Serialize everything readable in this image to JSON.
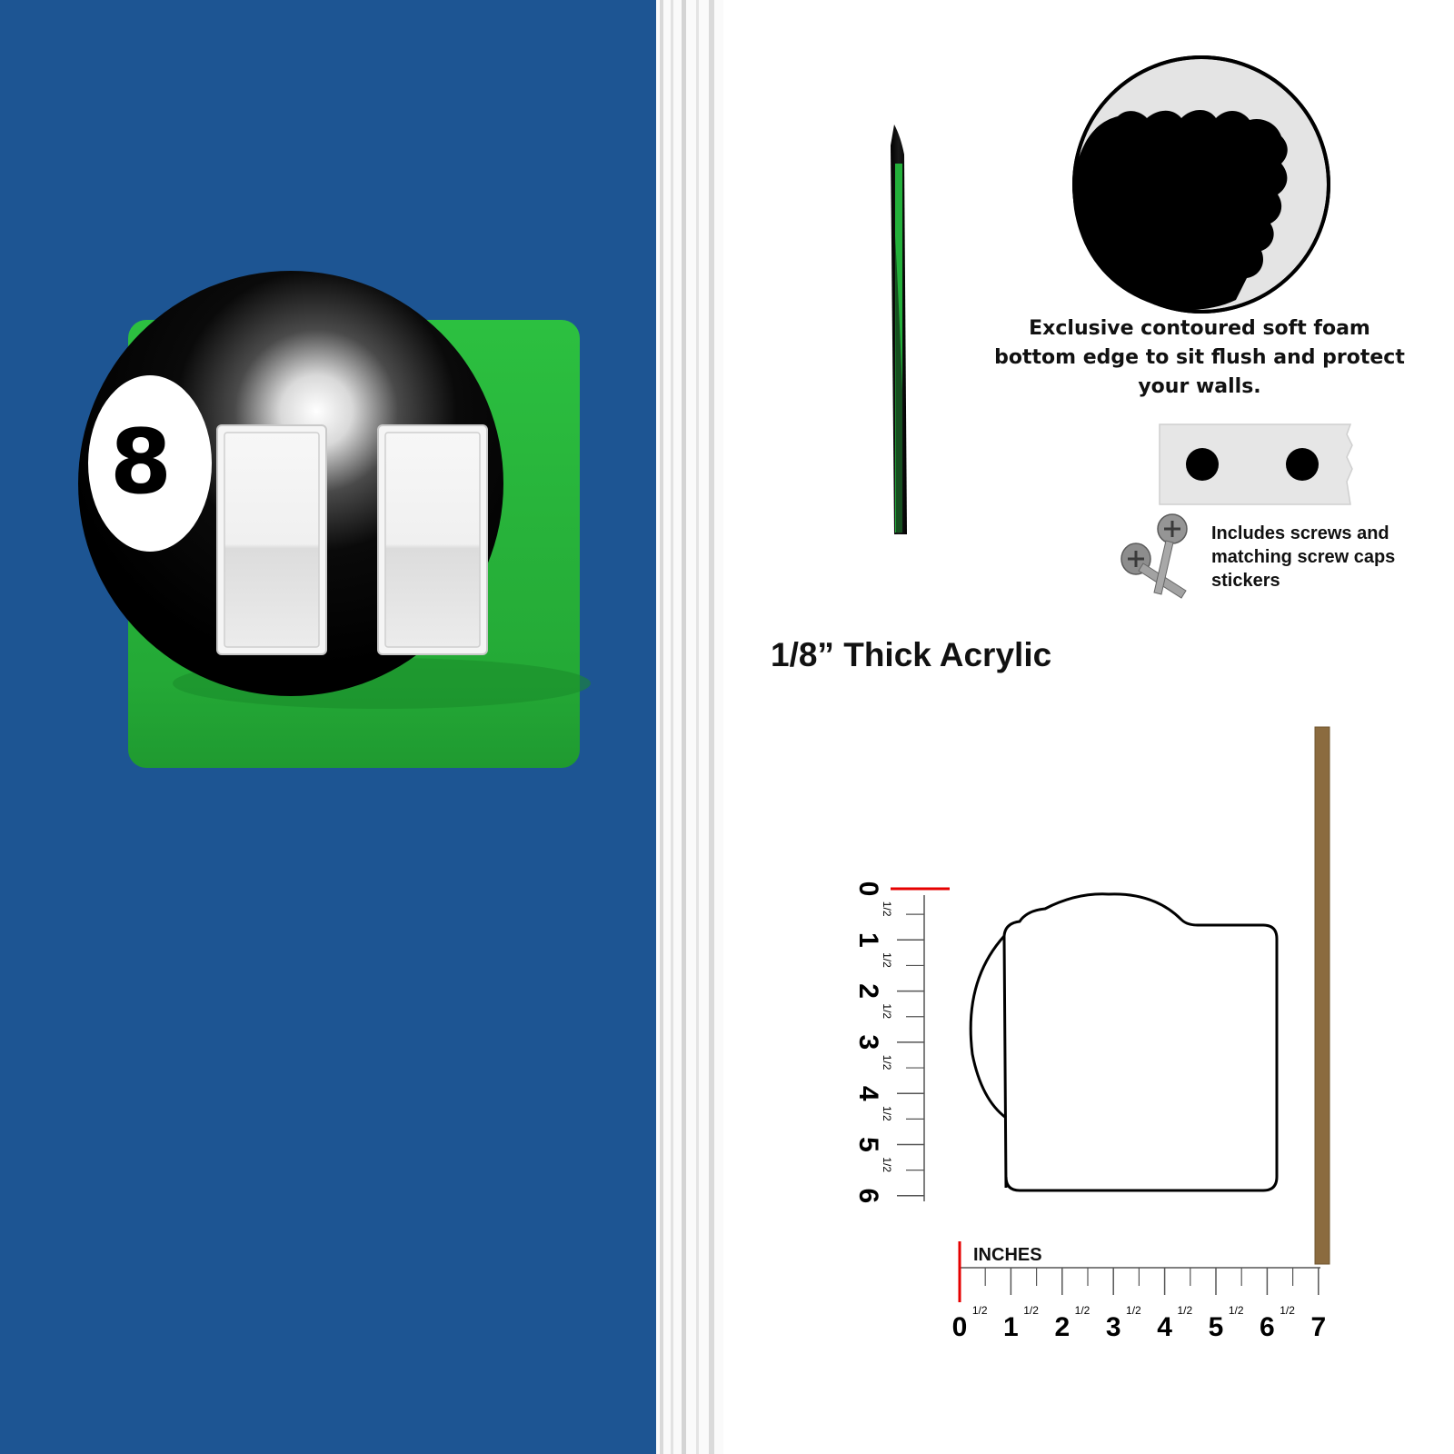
{
  "product": {
    "ball_number": "8",
    "colors": {
      "wall": "#1d5593",
      "felt": "#2ab33c",
      "ball": "#050505",
      "switch": "#f2f2f2",
      "ruler_zero_mark": "#e60000",
      "board_edge": "#8b6b3f"
    },
    "switch_count": 2
  },
  "features": {
    "thickness_label": "1/8” Thick Acrylic",
    "foam_caption": "Exclusive contoured soft foam bottom edge to sit flush and protect your walls.",
    "screws_caption": "Includes screws and matching screw caps stickers"
  },
  "dimensions": {
    "unit_label": "INCHES",
    "half_label": "1/2",
    "width_in": 7,
    "height_in": 6,
    "horizontal_ticks": [
      "0",
      "1",
      "2",
      "3",
      "4",
      "5",
      "6",
      "7"
    ],
    "vertical_ticks": [
      "0",
      "1",
      "2",
      "3",
      "4",
      "5",
      "6"
    ]
  }
}
